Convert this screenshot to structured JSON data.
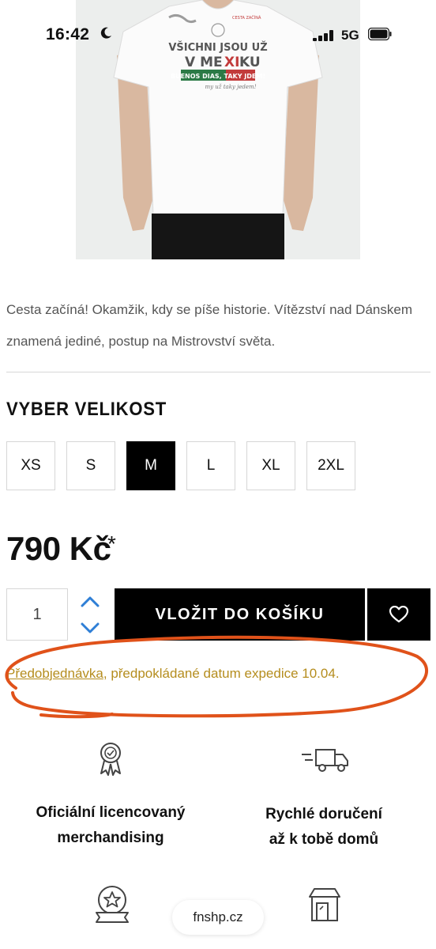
{
  "status_bar": {
    "time": "16:42",
    "network": "5G"
  },
  "product": {
    "image_alt": "VŠICHNI JSOU UŽ V MEXIKU",
    "description": "Cesta začíná! Okamžik, kdy se píše historie. Vítězství nad Dánskem znamená jediné, postup na Mistrovství světa.",
    "size_heading": "VYBER VELIKOST",
    "sizes": [
      "XS",
      "S",
      "M",
      "L",
      "XL",
      "2XL"
    ],
    "selected_size": "M",
    "price": "790 Kč",
    "price_note": "*",
    "quantity": "1",
    "add_to_cart_label": "VLOŽIT DO KOŠÍKU",
    "preorder_link": "Předobjednávka",
    "preorder_text": ", předpokládané datum expedice 10.04."
  },
  "features": [
    {
      "icon": "award-badge-icon",
      "line1": "Oficiální licencovaný",
      "line2": "merchandising"
    },
    {
      "icon": "delivery-truck-icon",
      "line1": "Rychlé doručení",
      "line2": "až k tobě domů"
    },
    {
      "icon": "star-badge-icon"
    },
    {
      "icon": "store-icon"
    }
  ],
  "browser": {
    "domain": "fnshp.cz"
  },
  "colors": {
    "accent_text": "#b58d1e",
    "annotation": "#e0521a",
    "button": "#000000"
  }
}
